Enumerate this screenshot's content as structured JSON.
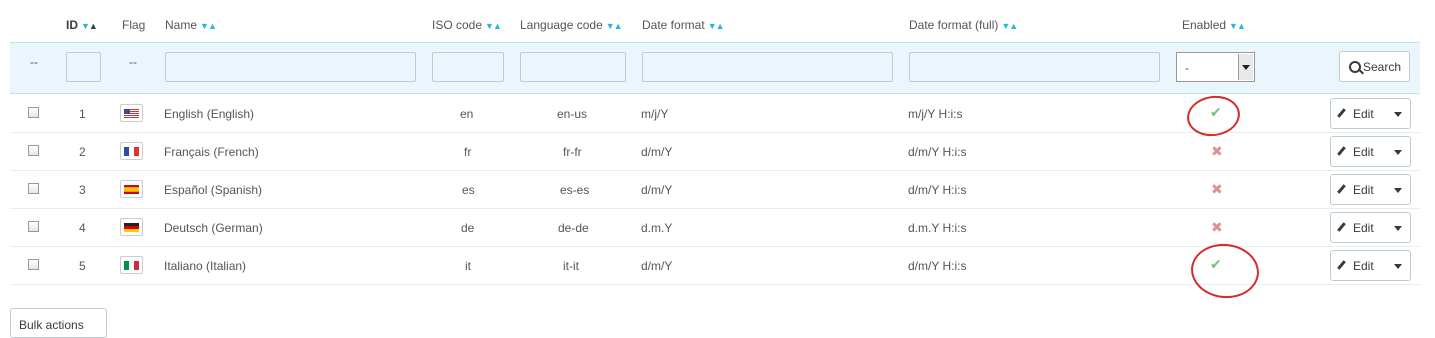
{
  "header": {
    "id": "ID",
    "flag": "Flag",
    "name": "Name",
    "iso": "ISO code",
    "language_code": "Language code",
    "date_format": "Date format",
    "date_format_full": "Date format (full)",
    "enabled": "Enabled"
  },
  "filters": {
    "bulk_placeholder": "--",
    "flag_placeholder": "--",
    "enabled_value": "-",
    "search_label": "Search"
  },
  "rows": [
    {
      "id": "1",
      "name": "English (English)",
      "iso": "en",
      "lang": "en-us",
      "date": "m/j/Y",
      "date_full": "m/j/Y H:i:s",
      "enabled": true,
      "edit": "Edit"
    },
    {
      "id": "2",
      "name": "Français (French)",
      "iso": "fr",
      "lang": "fr-fr",
      "date": "d/m/Y",
      "date_full": "d/m/Y H:i:s",
      "enabled": false,
      "edit": "Edit"
    },
    {
      "id": "3",
      "name": "Español (Spanish)",
      "iso": "es",
      "lang": "es-es",
      "date": "d/m/Y",
      "date_full": "d/m/Y H:i:s",
      "enabled": false,
      "edit": "Edit"
    },
    {
      "id": "4",
      "name": "Deutsch (German)",
      "iso": "de",
      "lang": "de-de",
      "date": "d.m.Y",
      "date_full": "d.m.Y H:i:s",
      "enabled": false,
      "edit": "Edit"
    },
    {
      "id": "5",
      "name": "Italiano (Italian)",
      "iso": "it",
      "lang": "it-it",
      "date": "d/m/Y",
      "date_full": "d/m/Y H:i:s",
      "enabled": true,
      "edit": "Edit"
    }
  ],
  "icons": {
    "yes": "check-icon",
    "no": "cross-icon",
    "flags": [
      "flag-us-icon",
      "flag-fr-icon",
      "flag-es-icon",
      "flag-de-icon",
      "flag-it-icon"
    ]
  },
  "bulk_actions": "Bulk actions",
  "colors": {
    "accent": "#25b9d7",
    "enabled": "#72c279",
    "disabled": "#e08f95",
    "annotation": "#d42b2b"
  }
}
